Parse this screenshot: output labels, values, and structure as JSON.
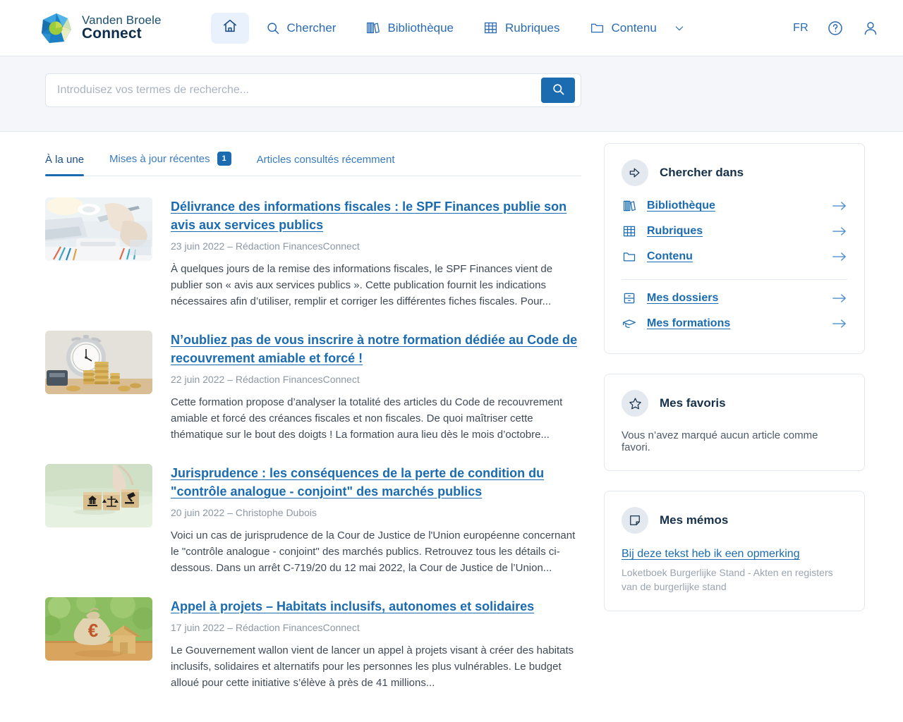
{
  "brand": {
    "line1": "Vanden Broele",
    "line2": "Connect",
    "logo_icon": "vanden-broele-polygon-logo"
  },
  "header": {
    "nav": [
      {
        "label": "",
        "icon": "home-icon",
        "name": "nav-home",
        "active": true
      },
      {
        "label": "Chercher",
        "icon": "search-icon",
        "name": "nav-chercher",
        "active": false
      },
      {
        "label": "Bibliothèque",
        "icon": "books-icon",
        "name": "nav-bibliotheque",
        "active": false
      },
      {
        "label": "Rubriques",
        "icon": "grid-icon",
        "name": "nav-rubriques",
        "active": false
      },
      {
        "label": "Contenu",
        "icon": "folder-icon",
        "name": "nav-contenu",
        "active": false,
        "has_chevron": true
      }
    ],
    "language": "FR",
    "help_icon": "question-circle-icon",
    "account_icon": "user-icon"
  },
  "search": {
    "placeholder": "Introduisez vos termes de recherche...",
    "value": "",
    "button_icon": "search-icon",
    "button_color": "#1a6bb0"
  },
  "tabs": [
    {
      "label": "À la une",
      "badge": null,
      "active": true
    },
    {
      "label": "Mises à jour récentes",
      "badge": "1",
      "active": false
    },
    {
      "label": "Articles consultés récemment",
      "badge": null,
      "active": false
    }
  ],
  "articles": [
    {
      "title": "Délivrance des informations fiscales : le SPF Finances publie son avis aux services publics",
      "date": "23 juin 2022",
      "author": "Rédaction FinancesConnect",
      "meta": "23 juin 2022 – Rédaction FinancesConnect",
      "excerpt": "À quelques jours de la remise des informations fiscales, le SPF Finances vient de publier son « avis aux services publics ». Cette publication fournit les indications nécessaires afin d’utiliser, remplir et corriger les différentes fiches fiscales. Pour...",
      "thumb": "desk-calculator-hands-photo"
    },
    {
      "title": "N’oubliez pas de vous inscrire à notre formation dédiée au Code de recouvrement amiable et forcé !",
      "date": "22 juin 2022",
      "author": "Rédaction FinancesConnect",
      "meta": "22 juin 2022 – Rédaction FinancesConnect",
      "excerpt": "Cette formation propose d’analyser la totalité des articles du Code de recouvrement amiable et forcé des créances fiscales et non fiscales. De quoi maîtriser cette thématique sur le bout des doigts ! La formation aura lieu dès le mois d’octobre...",
      "thumb": "alarm-clock-coins-photo"
    },
    {
      "title": "Jurisprudence : les conséquences de la perte de condition du \"contrôle analogue - conjoint\" des marchés publics",
      "date": "20 juin 2022",
      "author": "Christophe Dubois",
      "meta": "20 juin 2022 – Christophe Dubois",
      "excerpt": "Voici un cas de jurisprudence de la Cour de Justice de l'Union européenne concernant le \"contrôle analogue - conjoint\" des marchés publics. Retrouvez tous les détails ci-dessous. Dans un arrêt C-719/20 du 12 mai 2022, la Cour de Justice de l’Union...",
      "thumb": "wooden-blocks-justice-photo"
    },
    {
      "title": "Appel à projets – Habitats inclusifs, autonomes et solidaires",
      "date": "17 juin 2022",
      "author": "Rédaction FinancesConnect",
      "meta": "17 juin 2022 – Rédaction FinancesConnect",
      "excerpt": "Le Gouvernement wallon vient de lancer un appel à projets visant à créer des habitats inclusifs, solidaires et alternatifs pour les personnes les plus vulnérables. Le budget alloué pour cette initiative s’élève à près de 41 millions...",
      "thumb": "money-bag-house-photo"
    }
  ],
  "sidebar": {
    "search_in_card": {
      "title": "Chercher dans",
      "icon": "arrow-into-box-icon",
      "links_primary": [
        {
          "label": "Bibliothèque",
          "icon": "books-icon",
          "arrow": "arrow-right-icon"
        },
        {
          "label": "Rubriques",
          "icon": "grid-icon",
          "arrow": "arrow-right-icon"
        },
        {
          "label": "Contenu",
          "icon": "folder-icon",
          "arrow": "arrow-right-icon"
        }
      ],
      "links_secondary": [
        {
          "label": "Mes dossiers",
          "icon": "drawer-icon",
          "arrow": "arrow-right-icon"
        },
        {
          "label": "Mes formations",
          "icon": "graduation-cap-icon",
          "arrow": "arrow-right-icon"
        }
      ]
    },
    "favorites_card": {
      "title": "Mes favoris",
      "icon": "star-icon",
      "empty_message": "Vous n’avez marqué aucun article comme favori."
    },
    "memos_card": {
      "title": "Mes mémos",
      "icon": "note-icon",
      "items": [
        {
          "link": "Bij deze tekst heb ik een opmerking",
          "subtitle": "Loketboek Burgerlijke Stand - Akten en registers van de burgerlijke stand"
        }
      ]
    }
  },
  "colors": {
    "accent": "#1a6bb0",
    "link": "#1a6bb0",
    "band_bg": "#f4f6fa",
    "border": "#e3e8ef",
    "muted_text": "#8c98a6"
  }
}
